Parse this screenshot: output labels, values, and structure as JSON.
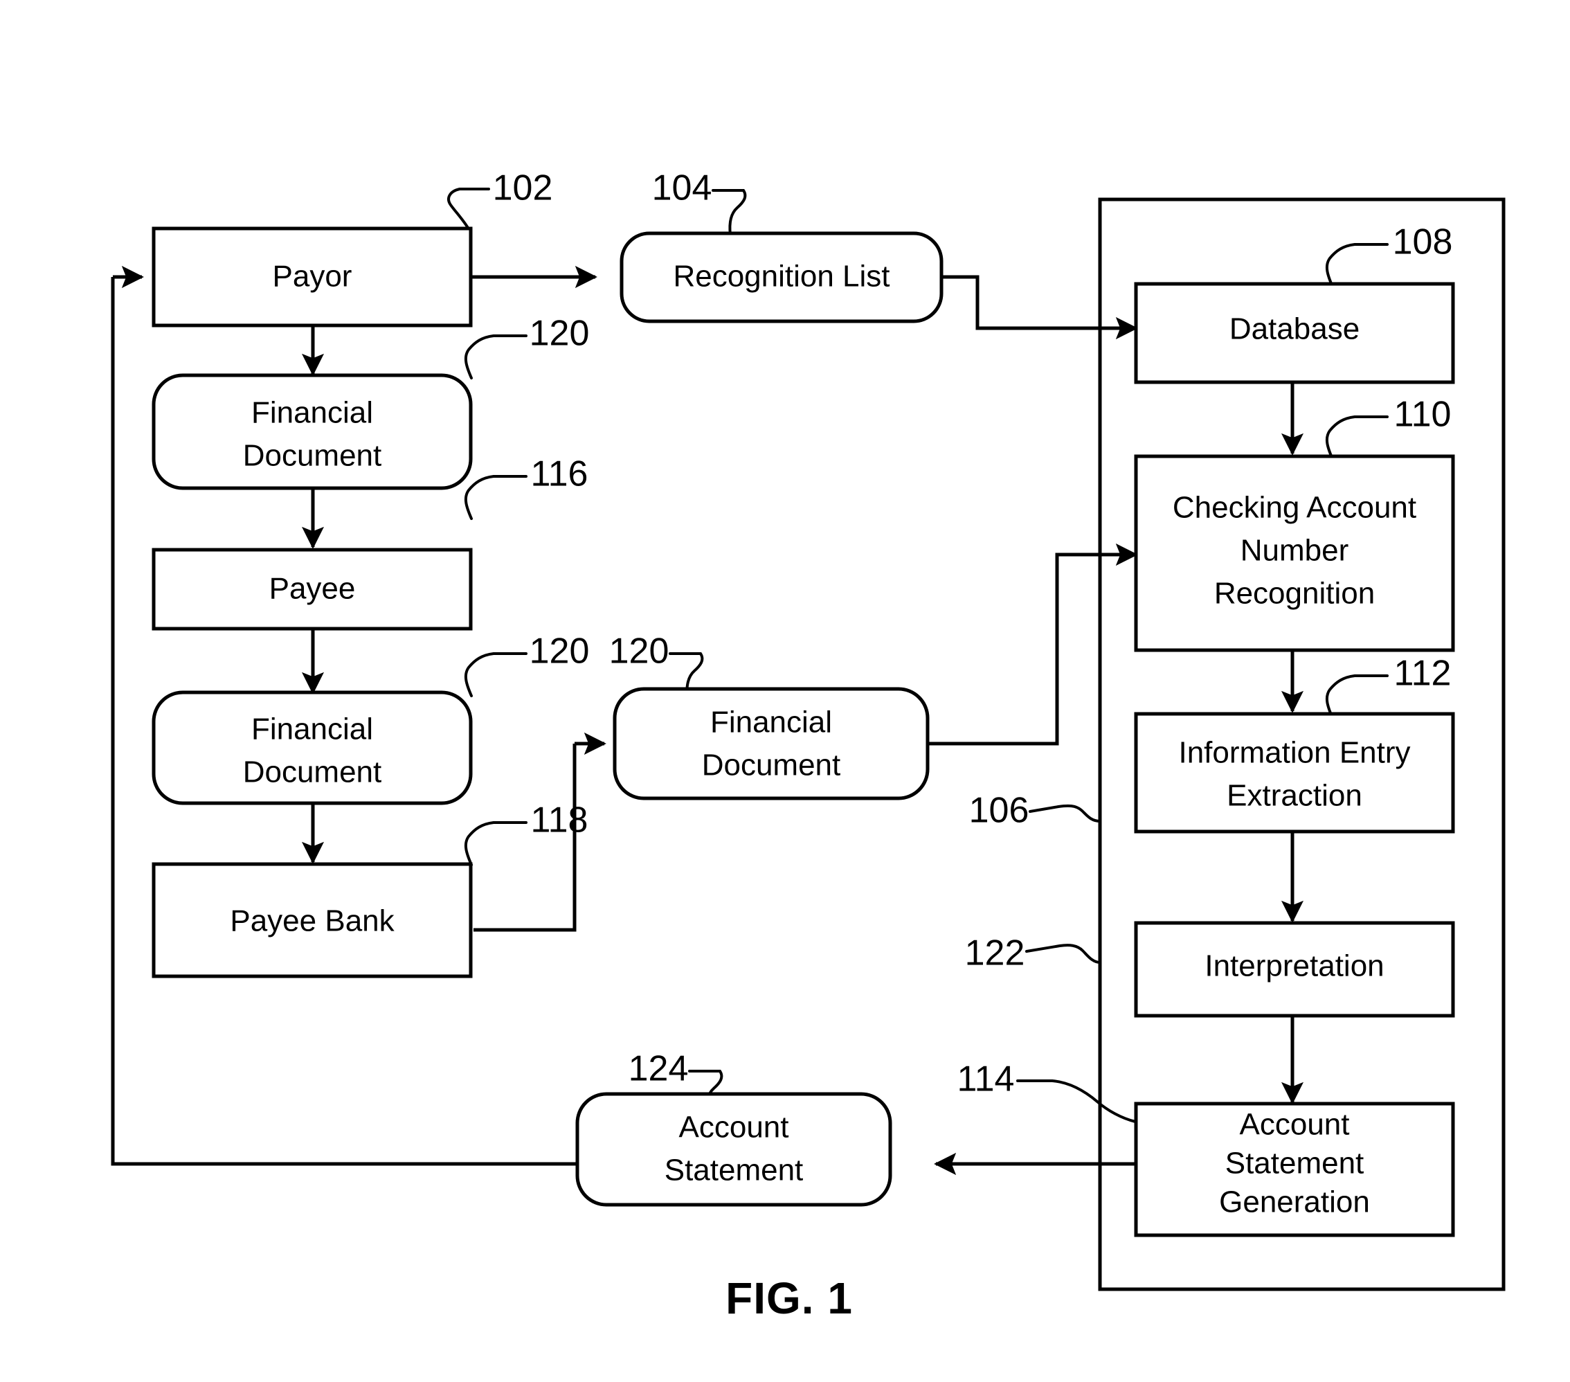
{
  "figure": {
    "caption": "FIG. 1",
    "type": "patent-flow-diagram"
  },
  "boxes": {
    "payor": {
      "label": "Payor",
      "ref": "102",
      "shape": "rect"
    },
    "recognition_list": {
      "label": "Recognition List",
      "ref": "104",
      "shape": "rounded"
    },
    "financial_document_top": {
      "label_line1": "Financial",
      "label_line2": "Document",
      "ref": "120",
      "shape": "rounded"
    },
    "payee": {
      "label": "Payee",
      "ref": "116",
      "shape": "rect"
    },
    "financial_document_mid_left": {
      "label_line1": "Financial",
      "label_line2": "Document",
      "ref": "120",
      "shape": "rounded"
    },
    "payee_bank": {
      "label": "Payee Bank",
      "ref": "118",
      "shape": "rect"
    },
    "financial_document_center": {
      "label_line1": "Financial",
      "label_line2": "Document",
      "ref": "120",
      "shape": "rounded"
    },
    "database": {
      "label": "Database",
      "ref": "108",
      "shape": "rect"
    },
    "checking_account_number_recognition": {
      "label_line1": "Checking Account",
      "label_line2": "Number",
      "label_line3": "Recognition",
      "ref": "110",
      "shape": "rect"
    },
    "information_entry_extraction": {
      "label_line1": "Information Entry",
      "label_line2": "Extraction",
      "ref": "112",
      "shape": "rect"
    },
    "interpretation": {
      "label": "Interpretation",
      "ref": "122",
      "shape": "rect"
    },
    "account_statement_generation": {
      "label_line1": "Account",
      "label_line2": "Statement",
      "label_line3": "Generation",
      "ref": "114",
      "shape": "rect"
    },
    "account_statement": {
      "label_line1": "Account",
      "label_line2": "Statement",
      "ref": "124",
      "shape": "rounded"
    },
    "processing_system_container": {
      "ref": "106",
      "shape": "container"
    }
  },
  "reference_numerals": {
    "n102": "102",
    "n104": "104",
    "n106": "106",
    "n108": "108",
    "n110": "110",
    "n112": "112",
    "n114": "114",
    "n116": "116",
    "n118": "118",
    "n120_top": "120",
    "n120_mid": "120",
    "n120_center": "120",
    "n122": "122",
    "n124": "124"
  },
  "colors": {
    "stroke": "#000000",
    "background": "#ffffff"
  }
}
